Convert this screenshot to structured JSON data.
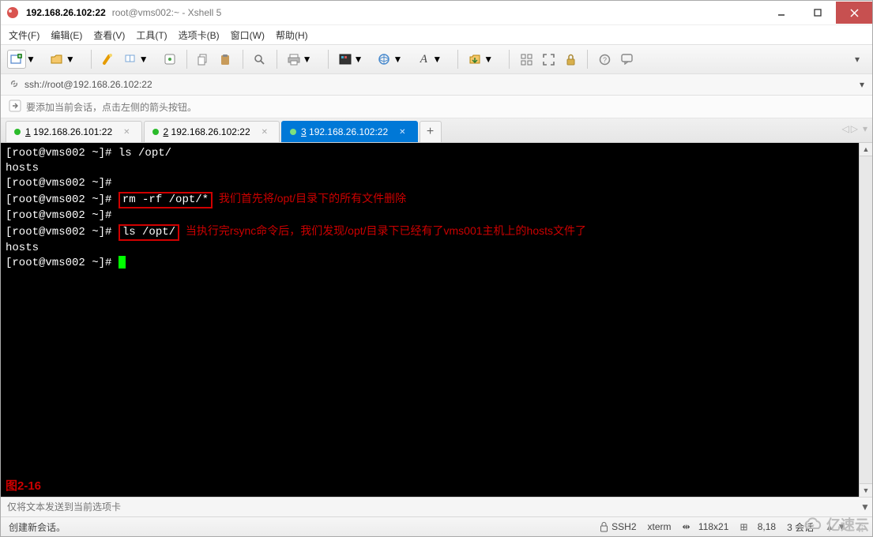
{
  "title": {
    "main": "192.168.26.102:22",
    "sub": "root@vms002:~ - Xshell 5"
  },
  "menubar": [
    "文件(F)",
    "编辑(E)",
    "查看(V)",
    "工具(T)",
    "选项卡(B)",
    "窗口(W)",
    "帮助(H)"
  ],
  "address": {
    "icon": "link-icon",
    "text": "ssh://root@192.168.26.102:22"
  },
  "hint": {
    "icon": "arrow-icon",
    "text": "要添加当前会话，点击左侧的箭头按钮。"
  },
  "tabs": [
    {
      "label": "1 192.168.26.101:22",
      "active": false
    },
    {
      "label": "2 192.168.26.102:22",
      "active": false
    },
    {
      "label": "3 192.168.26.102:22",
      "active": true
    }
  ],
  "terminal": {
    "lines": [
      {
        "prompt": "[root@vms002 ~]# ",
        "cmd": "ls /opt/"
      },
      {
        "plain": "hosts"
      },
      {
        "prompt": "[root@vms002 ~]#"
      },
      {
        "prompt": "[root@vms002 ~]# ",
        "boxed": "rm -rf /opt/*",
        "anno": "  我们首先将/opt/目录下的所有文件删除"
      },
      {
        "prompt": "[root@vms002 ~]#"
      },
      {
        "prompt": "[root@vms002 ~]# ",
        "boxed": "ls /opt/",
        "anno": "  当执行完rsync命令后，我们发现/opt/目录下已经有了vms001主机上的hosts文件了"
      },
      {
        "plain": "hosts"
      },
      {
        "prompt": "[root@vms002 ~]# ",
        "cursor": true
      }
    ],
    "figure_label": "图2-16"
  },
  "sendbar": {
    "placeholder": "仅将文本发送到当前选项卡"
  },
  "status": {
    "left": "创建新会话。",
    "ssh": "SSH2",
    "term": "xterm",
    "size": "118x21",
    "pos": "8,18",
    "sessions": "3 会话"
  },
  "watermark": "亿速云",
  "toolbar_icons": [
    "new-session",
    "open",
    "reconnect",
    "disconnect",
    "copy",
    "paste",
    "search",
    "print",
    "properties",
    "color-scheme",
    "font",
    "encoding",
    "transfer",
    "fullscreen",
    "transparent",
    "lock",
    "help",
    "feedback"
  ]
}
